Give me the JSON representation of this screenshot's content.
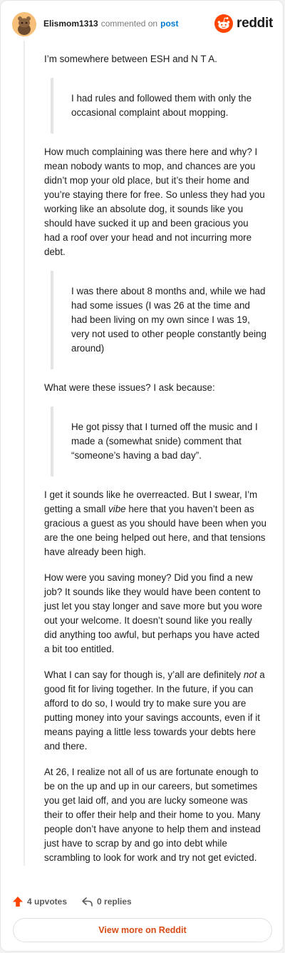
{
  "header": {
    "username": "Elismom1313",
    "action": "commented on",
    "post_link": "post",
    "brand": "reddit"
  },
  "comment": {
    "p1": "I’m somewhere between ESH and N T A.",
    "quote1": "I had rules and followed them with only the occasional complaint about mopping.",
    "p2": "How much complaining was there here and why? I mean nobody wants to mop, and chances are you didn’t mop your old place, but it’s their home and you’re staying there for free. So unless they had you working like an absolute dog, it sounds like you should have sucked it up and been gracious you had a roof over your head and not incurring more debt.",
    "quote2": "I was there about 8 months and, while we had had some issues (I was 26 at the time and had been living on my own since I was 19, very not used to other people constantly being around)",
    "p3": "What were these issues? I ask because:",
    "quote3": "He got pissy that I turned off the music and I made a (somewhat snide) comment that “someone’s having a bad day”.",
    "p4_before": "I get it sounds like he overreacted. But I swear, I’m getting a small ",
    "p4_em": "vibe",
    "p4_after": " here that you haven’t been as gracious a guest as you should have been when you are the one being helped out here, and that tensions have already been high.",
    "p5": "How were you saving money? Did you find a new job? It sounds like they would have been content to just let you stay longer and save more but you wore out your welcome. It doesn’t sound like you really did anything too awful, but perhaps you have acted a bit too entitled.",
    "p6_before": "What I can say for though is, y’all are definitely ",
    "p6_em": "not",
    "p6_after": " a good fit for living together. In the future, if you can afford to do so, I would try to make sure you are putting money into your savings accounts, even if it means paying a little less towards your debts here and there.",
    "p7": "At 26, I realize not all of us are fortunate enough to be on the up and up in our careers, but sometimes you get laid off, and you are lucky someone was their to offer their help and their home to you. Many people don’t have anyone to help them and instead just have to scrap by and go into debt while scrambling to look for work and try not get evicted."
  },
  "footer": {
    "upvotes": "4 upvotes",
    "replies": "0 replies",
    "view_more": "View more on Reddit"
  },
  "colors": {
    "accent": "#ff4500",
    "link": "#0079d3",
    "button_text": "#d84a16"
  },
  "icons": {
    "avatar": "snoo-avatar",
    "brand": "reddit-logo-icon",
    "upvote": "upvote-arrow-icon",
    "reply": "reply-arrow-icon"
  }
}
